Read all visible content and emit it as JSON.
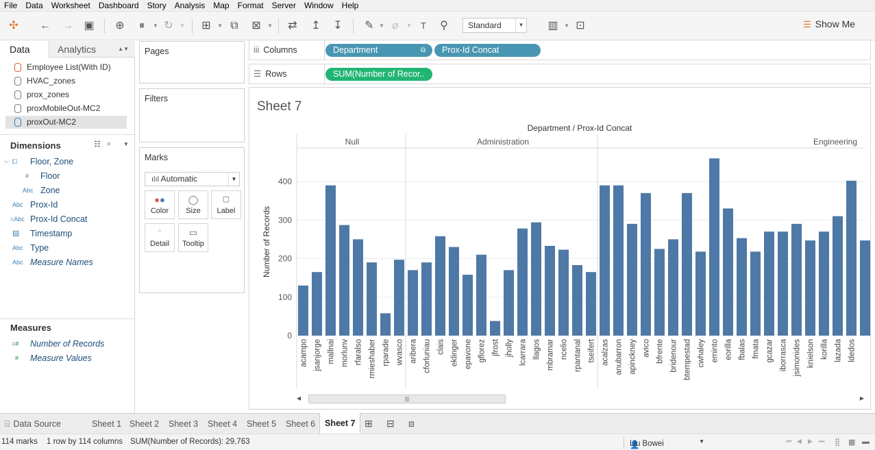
{
  "menu": [
    "File",
    "Data",
    "Worksheet",
    "Dashboard",
    "Story",
    "Analysis",
    "Map",
    "Format",
    "Server",
    "Window",
    "Help"
  ],
  "toolbar": {
    "icons": [
      "tableau-logo-icon",
      "undo-icon",
      "redo-icon",
      "save-icon",
      "new-datasource-icon",
      "pause-updates-icon",
      "refresh-icon",
      "new-worksheet-icon",
      "duplicate-sheet-icon",
      "clear-sheet-icon",
      "swap-icon",
      "sort-ascending-icon",
      "sort-descending-icon",
      "highlight-icon",
      "group-icon",
      "text-label-icon",
      "pin-icon",
      "chart-type-icon",
      "presentation-icon"
    ],
    "fit": "Standard",
    "show_me": "Show Me"
  },
  "data_pane": {
    "tab_data": "Data",
    "tab_analytics": "Analytics",
    "sources": [
      "Employee List(With ID)",
      "HVAC_zones",
      "prox_zones",
      "proxMobileOut-MC2",
      "proxOut-MC2"
    ],
    "dimensions_title": "Dimensions",
    "dimensions": [
      {
        "type": "",
        "name": "Floor, Zone"
      },
      {
        "type": "#",
        "name": "Floor"
      },
      {
        "type": "Abc",
        "name": "Zone"
      },
      {
        "type": "Abc",
        "name": "Prox-Id"
      },
      {
        "type": "=Abc",
        "name": "Prox-Id Concat"
      },
      {
        "type": "",
        "name": "Timestamp"
      },
      {
        "type": "Abc",
        "name": "Type"
      },
      {
        "type": "Abc",
        "name": "Measure Names"
      }
    ],
    "measures_title": "Measures",
    "measures": [
      {
        "type": "=#",
        "name": "Number of Records"
      },
      {
        "type": "#",
        "name": "Measure Values"
      }
    ]
  },
  "cards": {
    "pages": "Pages",
    "filters": "Filters",
    "marks": "Marks",
    "mark_type": "Automatic",
    "mark_buttons": [
      "Color",
      "Size",
      "Label",
      "Detail",
      "Tooltip"
    ]
  },
  "shelves": {
    "columns_label": "Columns",
    "rows_label": "Rows",
    "column_pills": [
      "Department",
      "Prox-Id Concat"
    ],
    "row_pills": [
      "SUM(Number of Recor.."
    ]
  },
  "view": {
    "sheet_title": "Sheet 7",
    "header_title": "Department / Prox-Id Concat"
  },
  "chart_data": {
    "type": "bar",
    "title": "Department / Prox-Id Concat",
    "ylabel": "Number of Records",
    "ylim": [
      0,
      460
    ],
    "yticks": [
      0,
      100,
      200,
      300,
      400
    ],
    "grid": true,
    "groups": [
      {
        "name": "Null",
        "categories": [
          "acampo",
          "jsanjorge",
          "mallnai",
          "morlunv",
          "rfaralso",
          "rmieshaber",
          "rparade",
          "wvasco"
        ],
        "values": [
          130,
          165,
          390,
          287,
          250,
          190,
          58,
          197
        ]
      },
      {
        "name": "Administration",
        "categories": [
          "aribera",
          "cforluniau",
          "clais",
          "eklinger",
          "epavone",
          "gflorez",
          "jfrost",
          "jholly",
          "lcarrara",
          "llagos",
          "mbramar",
          "ncelio",
          "rpantanal",
          "tseifert"
        ],
        "values": [
          170,
          190,
          258,
          230,
          158,
          210,
          38,
          170,
          278,
          294,
          233,
          223,
          183,
          165
        ]
      },
      {
        "name": "Engineering",
        "categories": [
          "acalzas",
          "anubarron",
          "apinckney",
          "avico",
          "bfrente",
          "bridenour",
          "btempestad",
          "cwhaley",
          "eminto",
          "eorilla",
          "fbalas",
          "fmata",
          "gcazar",
          "iborrasca",
          "jsimonides",
          "knielson",
          "korilla",
          "lazada",
          "ldedos",
          ""
        ],
        "values": [
          390,
          390,
          290,
          370,
          225,
          250,
          370,
          218,
          460,
          330,
          253,
          218,
          270,
          270,
          290,
          247,
          270,
          310,
          402,
          247
        ]
      }
    ],
    "bar_color": "#4e79a7"
  },
  "sheet_tabs": [
    "Data Source",
    "Sheet 1",
    "Sheet 2",
    "Sheet 3",
    "Sheet 4",
    "Sheet 5",
    "Sheet 6",
    "Sheet 7"
  ],
  "active_tab": "Sheet 7",
  "status": {
    "marks": "114 marks",
    "dims": "1 row by 114 columns",
    "sum": "SUM(Number of Records): 29,763",
    "user": "Liu Bowei"
  }
}
